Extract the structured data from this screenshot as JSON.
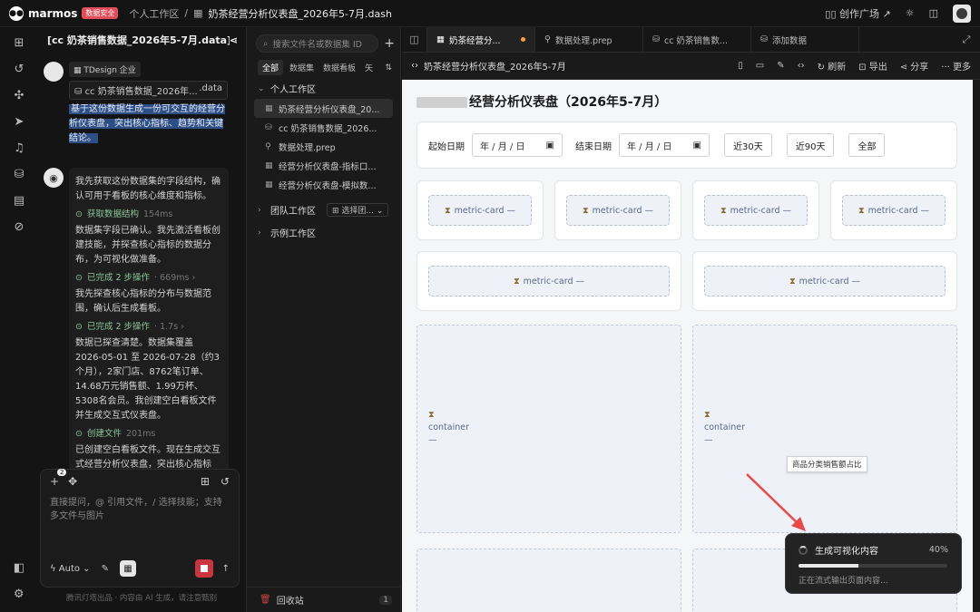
{
  "topbar": {
    "logo": "marmos",
    "badge": "数据安全",
    "crumb_workspace": "个人工作区",
    "crumb_sep": "/",
    "crumb_file": "奶茶经营分析仪表盘_2026年5-7月.dash",
    "creator_square": "创作广场"
  },
  "chat": {
    "title": "[cc 奶茶销售数据_2026年5-7月.data] ...",
    "user_tag": "TDesign 企业",
    "file_chip_name": "cc 奶茶销售数据_2026年...",
    "file_chip_ext": ".data",
    "user_text": "基于这份数据生成一份可交互的经营分析仪表盘，突出核心指标、趋势和关键结论。",
    "bot": {
      "p1": "我先获取这份数据集的字段结构，确认可用于看板的核心维度和指标。",
      "s1_label": "获取数据结构",
      "s1_ms": "154ms",
      "p2": "数据集字段已确认。我先激活看板创建技能，并探查核心指标的数据分布，为可视化做准备。",
      "s2_label": "已完成 2 步操作",
      "s2_ms": "· 669ms ›",
      "p3": "我先探查核心指标的分布与数据范围，确认后生成看板。",
      "s3_label": "已完成 2 步操作",
      "s3_ms": "· 1.7s ›",
      "p4": "数据已探查清楚。数据集覆盖 2026-05-01 至 2026-07-28（约3个月），2家门店、8762笔订单、14.68万元销售额、1.99万杯、5308名会员。我创建空白看板文件并生成交互式仪表盘。",
      "s4_label": "创建文件",
      "s4_ms": "201ms",
      "p5": "已创建空白看板文件。现在生成交互式经营分析仪表盘，突出核心指标"
    },
    "composer": {
      "attach_count": "2",
      "placeholder": "直接提问，@ 引用文件，/ 选择技能；支持多文件与图片",
      "mode": "Auto"
    },
    "footnote": "腾讯灯塔出品 · 内容由 AI 生成，请注意甄别"
  },
  "files": {
    "search_placeholder": "搜索文件名或数据集 ID",
    "tabs": [
      "全部",
      "数据集",
      "数据看板",
      "矢"
    ],
    "personal": "个人工作区",
    "items": [
      {
        "icon": "▦",
        "name": "奶茶经营分析仪表盘_20..."
      },
      {
        "icon": "⛁",
        "name": "cc 奶茶销售数据_2026..."
      },
      {
        "icon": "⚲",
        "name": "数据处理.prep"
      },
      {
        "icon": "▦",
        "name": "经营分析仪表盘-指标口..."
      },
      {
        "icon": "▦",
        "name": "经营分析仪表盘-模拟数..."
      }
    ],
    "team": "团队工作区",
    "team_select": "选择团... ⌄",
    "example": "示例工作区",
    "trash": "回收站",
    "trash_count": "1"
  },
  "editor": {
    "tabs": [
      {
        "icon": "▦",
        "label": "奶茶经营分..."
      },
      {
        "icon": "⚲",
        "label": "数据处理.prep"
      },
      {
        "icon": "⛁",
        "label": "cc 奶茶销售数..."
      },
      {
        "icon": "⛁",
        "label": "添加数据"
      }
    ],
    "breadcrumb": "奶茶经营分析仪表盘_2026年5-7月",
    "actions": {
      "refresh": "刷新",
      "export": "导出",
      "share": "分享",
      "more": "更多"
    }
  },
  "dashboard": {
    "title": "经营分析仪表盘（2026年5-7月）",
    "start_label": "起始日期",
    "end_label": "结束日期",
    "date_placeholder": "年 / 月 / 日",
    "btn_30": "近30天",
    "btn_90": "近90天",
    "btn_all": "全部",
    "metric_label": "metric-card —",
    "container_label": "container",
    "container_dash": "—",
    "tooltip": "商品分类销售额占比"
  },
  "toast": {
    "title": "生成可视化内容",
    "percent": "40%",
    "progress": 0.4,
    "subtitle": "正在流式输出页面内容..."
  }
}
